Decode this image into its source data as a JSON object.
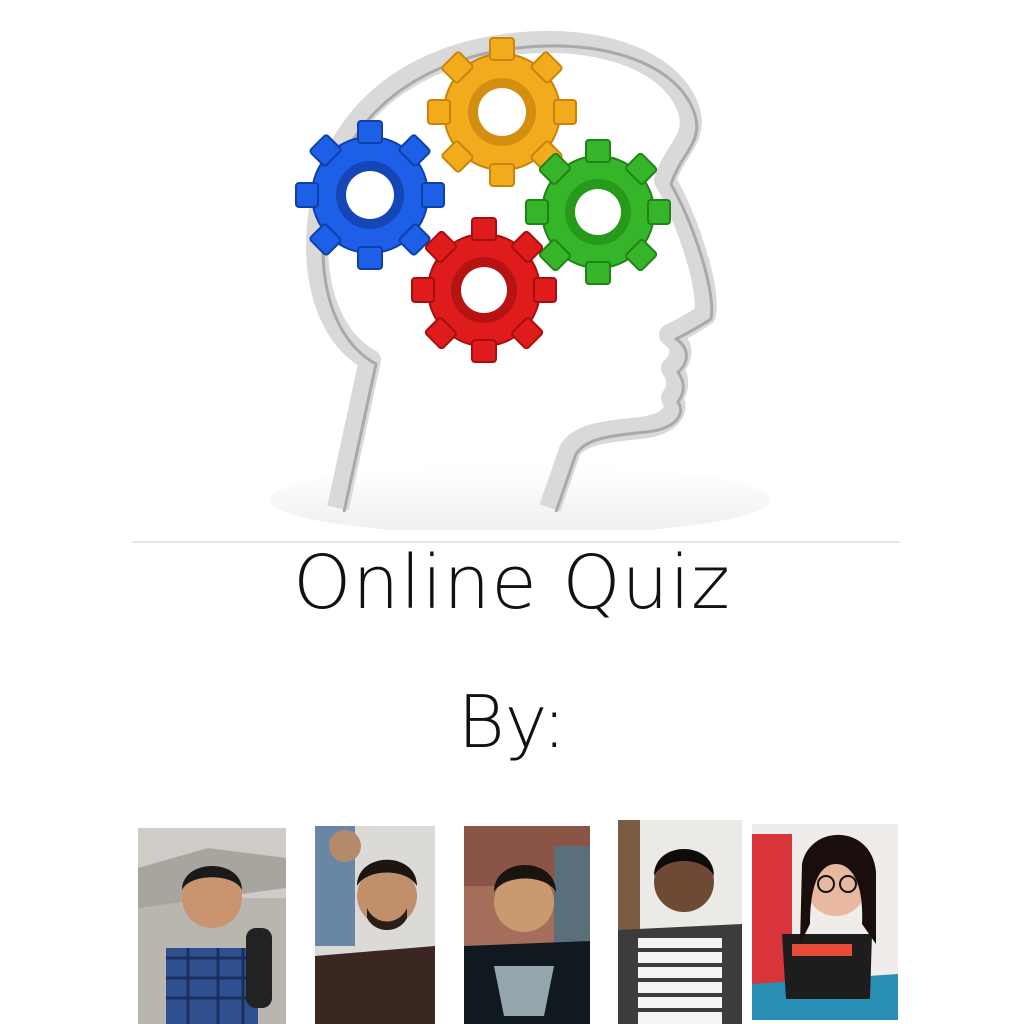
{
  "title": "Online Quiz",
  "byline": "By:",
  "colors": {
    "gear_yellow": "#f2ab1c",
    "gear_blue": "#1d5fe6",
    "gear_green": "#36b52a",
    "gear_red": "#e01b1b",
    "head_outline": "#d6d6d6"
  },
  "team_photos": [
    {
      "name": "member-1-photo"
    },
    {
      "name": "member-2-photo"
    },
    {
      "name": "member-3-photo"
    },
    {
      "name": "member-4-photo"
    },
    {
      "name": "member-5-photo"
    }
  ]
}
